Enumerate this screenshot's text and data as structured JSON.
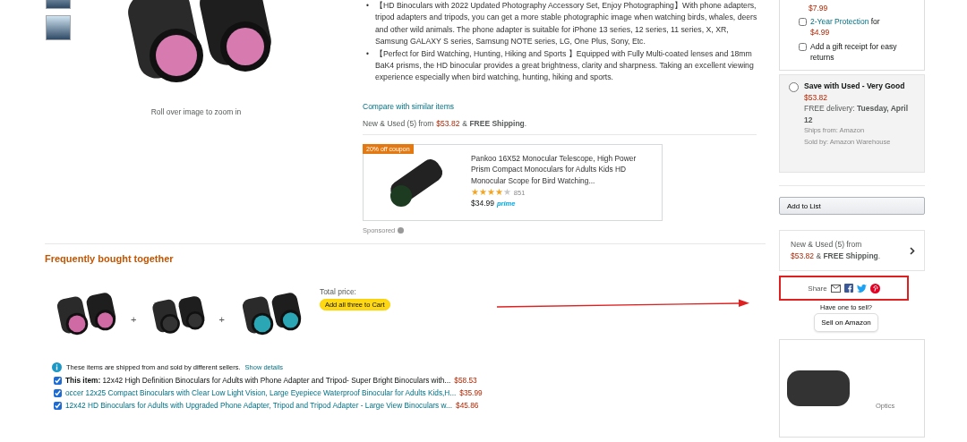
{
  "product_image": {
    "zoom_hint": "Roll over image to zoom in"
  },
  "bullets": [
    {
      "marker": "•",
      "text": "【HD Binoculars with 2022 Updated Photography Accessory Set, Enjoy Photographing】With phone adapters, tripod adapters and tripods, you can get a more stable photographic image when watching birds, whales, deers and other wild animals. The phone adapter is suitable for iPhone 13 series, 12 series, 11 series, X, XR, Samsung GALAXY S series, Samsung NOTE series, LG, One Plus, Sony, Etc."
    },
    {
      "marker": "•",
      "text": "【Perfect for Bird Watching, Hunting, Hiking and Sports 】Equipped with Fully Multi-coated lenses and 18mm BaK4 prisms, the HD binocular provides a great brightness, clarity and sharpness. Taking an excellent viewing experience especially when bird watching, hunting, hiking and sports."
    }
  ],
  "compare_link": "Compare with similar items",
  "new_used": {
    "prefix": "New & Used (5) from",
    "price": "$53.82",
    "suffix": "& **FREE Shipping**."
  },
  "sponsored": {
    "badge": "20% off coupon",
    "title": "Pankoo 16X52 Monocular Telescope, High Power Prism Compact Monoculars for Adults Kids HD Monocular Scope for Bird Watching...",
    "stars": 4,
    "review_count": "851",
    "price": "$34.99",
    "prime": "prime",
    "label": "Sponsored"
  },
  "frequently_bought": {
    "title": "Frequently bought together",
    "plus_signs": [
      "+",
      "+"
    ],
    "total_label": "Total price:",
    "add_button": "Add all three to Cart",
    "notice": "These items are shipped from and sold by different sellers.",
    "details_link": "Show details",
    "items": [
      {
        "checked": true,
        "lead": "This item:",
        "title": "12x42 High Definition Binoculars for Adults with Phone Adapter and Tripod- Super Bright Binoculars with...",
        "price": "$58.53"
      },
      {
        "checked": true,
        "title": "occer 12x25 Compact Binoculars with Clear Low Light Vision, Large Eyepiece Waterproof Binocular for Adults Kids,H...",
        "price": "$35.99"
      },
      {
        "checked": true,
        "title": "12x42 HD Binoculars for Adults with Upgraded Phone Adapter, Tripod and Tripod Adapter - Large View Binoculars w...",
        "price": "$45.86"
      }
    ]
  },
  "protection": {
    "cut_price": "$7.99",
    "options": [
      {
        "kind": "protection",
        "checked": false,
        "label": "2-Year Protection",
        "connector": "for",
        "price": "$4.99"
      },
      {
        "kind": "gift",
        "checked": false,
        "label": "Add a gift receipt for easy returns"
      }
    ]
  },
  "used_offer": {
    "selected": false,
    "title": "Save with Used - Very Good",
    "price": "$53.82",
    "delivery": "FREE delivery: **Tuesday, April 12**",
    "ships_from": "Ships from: Amazon",
    "sold_by": "Sold by: Amazon Warehouse"
  },
  "add_to_list": "Add to List",
  "new_used_box": {
    "prefix": "New & Used (5) from",
    "price": "$53.82",
    "suffix": "& **FREE Shipping**."
  },
  "share": {
    "label": "Share"
  },
  "sell": {
    "question": "Have one to sell?",
    "button": "Sell on Amazon"
  },
  "ad": {
    "caption": "Optics"
  },
  "annotations": {
    "arrow": true,
    "share_highlight": true
  }
}
